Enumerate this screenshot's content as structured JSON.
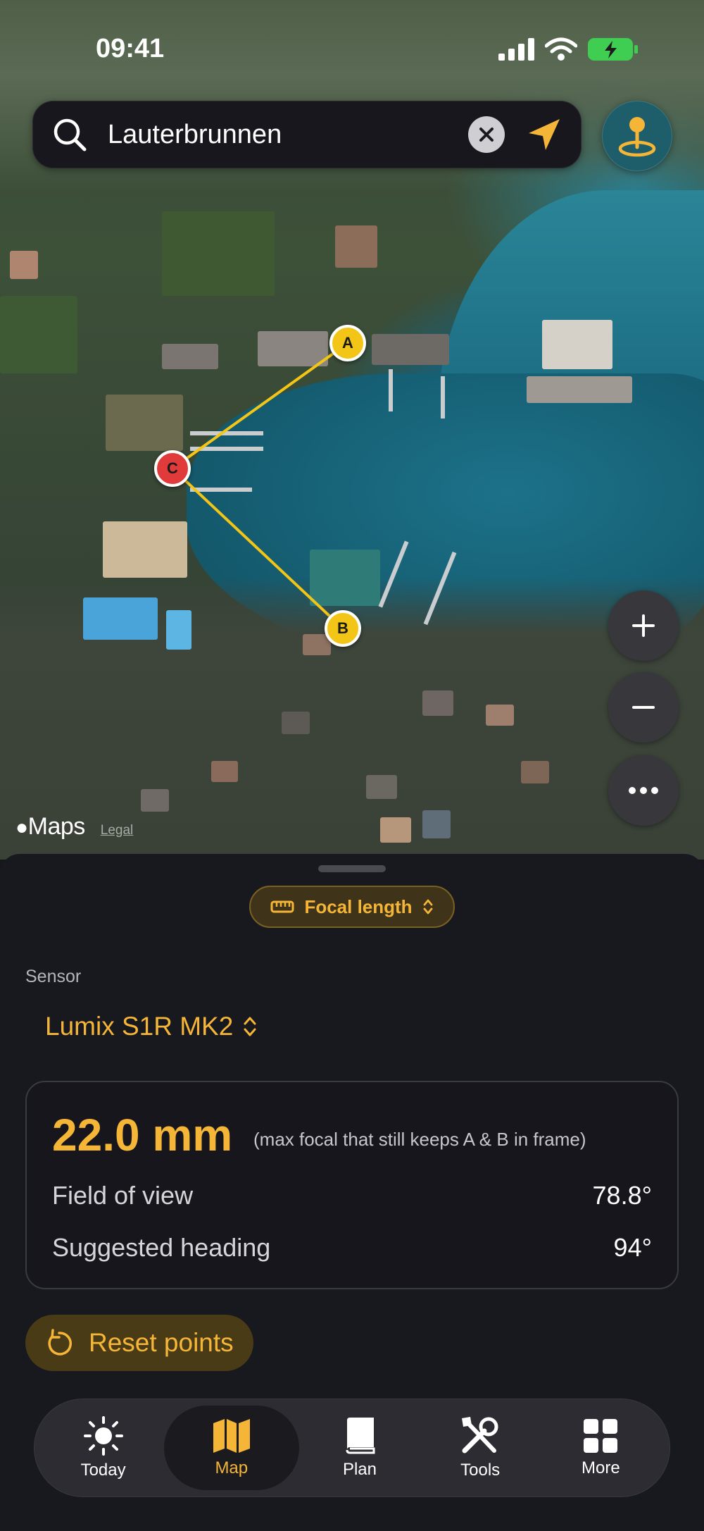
{
  "status_bar": {
    "time": "09:41"
  },
  "search": {
    "query": "Lauterbrunnen"
  },
  "map": {
    "attribution_logo": "Maps",
    "attribution_legal": "Legal",
    "points": [
      {
        "label": "A",
        "color": "#f2c516"
      },
      {
        "label": "B",
        "color": "#f2c516"
      },
      {
        "label": "C",
        "color": "#e03a3a"
      }
    ],
    "route_color": "#f2c516"
  },
  "sheet": {
    "mode_label": "Focal length",
    "sensor_label": "Sensor",
    "sensor_value": "Lumix S1R MK2",
    "result": {
      "focal": "22.0 mm",
      "note": "(max focal that still keeps A & B in frame)",
      "fov_label": "Field of view",
      "fov_value": "78.8°",
      "heading_label": "Suggested heading",
      "heading_value": "94°"
    },
    "reset_label": "Reset points"
  },
  "tabs": [
    {
      "label": "Today",
      "icon": "sun-icon"
    },
    {
      "label": "Map",
      "icon": "map-icon"
    },
    {
      "label": "Plan",
      "icon": "book-icon"
    },
    {
      "label": "Tools",
      "icon": "tools-icon"
    },
    {
      "label": "More",
      "icon": "grid-icon"
    }
  ],
  "accent_color": "#f5b537"
}
